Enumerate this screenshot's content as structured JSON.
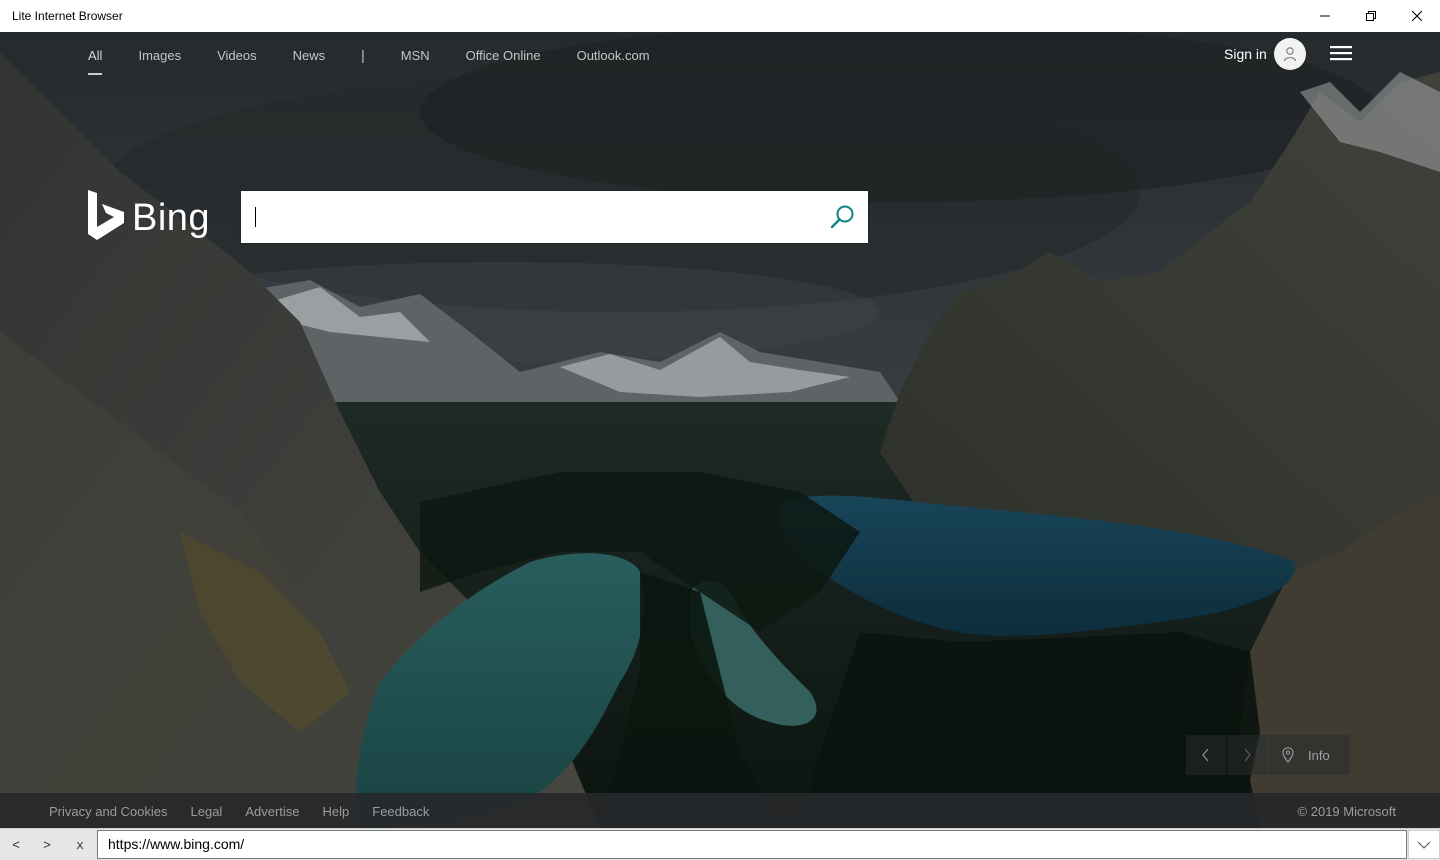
{
  "window": {
    "title": "Lite Internet Browser"
  },
  "topnav": {
    "links": [
      "All",
      "Images",
      "Videos",
      "News"
    ],
    "separator": "|",
    "links2": [
      "MSN",
      "Office Online",
      "Outlook.com"
    ],
    "signin": "Sign in"
  },
  "logo": {
    "text": "Bing"
  },
  "search": {
    "value": "",
    "placeholder": ""
  },
  "image_controls": {
    "info_label": "Info"
  },
  "footer": {
    "links": [
      "Privacy and Cookies",
      "Legal",
      "Advertise",
      "Help",
      "Feedback"
    ],
    "copyright": "© 2019 Microsoft"
  },
  "addressbar": {
    "back": "<",
    "forward": ">",
    "stop": "x",
    "url": "https://www.bing.com/"
  },
  "colors": {
    "logo": "#ffffff",
    "search_icon": "#0c8484",
    "footer_bg": "#26282a"
  },
  "icons": [
    "minimize-icon",
    "restore-icon",
    "close-icon",
    "user-icon",
    "hamburger-icon",
    "bing-logo-icon",
    "search-icon",
    "chevron-left-icon",
    "chevron-right-icon",
    "location-pin-icon",
    "chevron-down-icon"
  ]
}
